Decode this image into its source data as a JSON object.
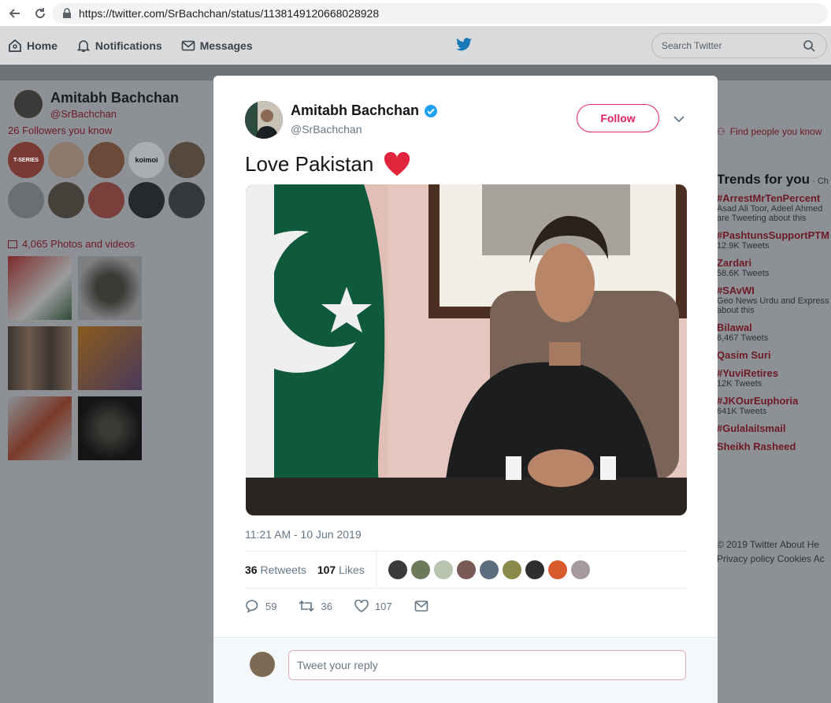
{
  "browser": {
    "url_host": "https://twitter.com/",
    "url_path": "SrBachchan/status/1138149120668028928"
  },
  "nav": {
    "home": "Home",
    "notifications": "Notifications",
    "messages": "Messages",
    "search_placeholder": "Search Twitter"
  },
  "background": {
    "name": "Amitabh Bachchan",
    "handle": "@SrBachchan",
    "followers_you_know": "26 Followers you know",
    "photos_videos": "4,065 Photos and videos",
    "find_people": "Find people you know",
    "trends_title": "Trends for you",
    "trends_suffix": " · Ch",
    "trends": [
      {
        "name": "#ArrestMrTenPercent",
        "sub": "Asad Ali Toor, Adeel Ahmed",
        "sub2": "are Tweeting about this"
      },
      {
        "name": "#PashtunsSupportPTM",
        "sub": "12.9K Tweets",
        "sub2": ""
      },
      {
        "name": "Zardari",
        "sub": "58.6K Tweets",
        "sub2": ""
      },
      {
        "name": "#SAvWI",
        "sub": "Geo News Urdu and Express",
        "sub2": "about this"
      },
      {
        "name": "Bilawal",
        "sub": "6,467 Tweets",
        "sub2": ""
      },
      {
        "name": "Qasim Suri",
        "sub": "",
        "sub2": ""
      },
      {
        "name": "#YuviRetires",
        "sub": "12K Tweets",
        "sub2": ""
      },
      {
        "name": "#JKOurEuphoria",
        "sub": "641K Tweets",
        "sub2": ""
      },
      {
        "name": "#GulalaiIsmail",
        "sub": "",
        "sub2": ""
      },
      {
        "name": "Sheikh Rasheed",
        "sub": "",
        "sub2": ""
      }
    ],
    "footer_line1": "© 2019 Twitter   About   He",
    "footer_line2": "Privacy policy   Cookies   Ac",
    "koimoi": "koimoi",
    "tseries": "T-SERIES"
  },
  "tweet": {
    "name": "Amitabh Bachchan",
    "handle": "@SrBachchan",
    "follow_label": "Follow",
    "text": "Love Pakistan",
    "timestamp": "11:21 AM - 10 Jun 2019",
    "retweets_count": "36",
    "retweets_label": "Retweets",
    "likes_count": "107",
    "likes_label": "Likes",
    "replies": "59",
    "retweets": "36",
    "likes": "107",
    "reply_placeholder": "Tweet your reply"
  },
  "colors": {
    "accent": "#e0245e",
    "verified": "#1da1f2",
    "flag_green": "#0f5a3d"
  }
}
